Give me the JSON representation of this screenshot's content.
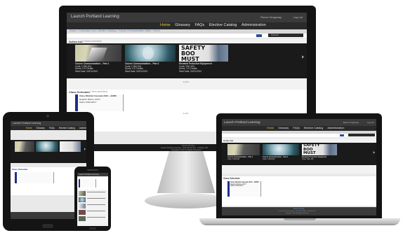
{
  "app": {
    "title": "Launch Portland Learning",
    "user_label": "Reece Kingsway",
    "logout_label": "Log out"
  },
  "nav": {
    "items": [
      {
        "label": "Home",
        "active": true
      },
      {
        "label": "Glossary",
        "active": false
      },
      {
        "label": "FAQs",
        "active": false
      },
      {
        "label": "Elective Catalog",
        "active": false
      },
      {
        "label": "Administration",
        "active": false
      }
    ]
  },
  "breadcrumb": {
    "text": "Home > Curriculum List > Elective Catalog > Course Communication Skills > Event"
  },
  "search": {
    "placeholder": "Search",
    "go_label": "Go"
  },
  "courses": {
    "header": "Active Ink",
    "sub": "(3 items selected)",
    "items": [
      {
        "title": "Course Communication – Part 1",
        "line1": "Code: COM-001",
        "line2": "Hours: 0.5 Credits",
        "line3": "Start Date: 02/01/2013"
      },
      {
        "title": "Course Communication – Part 2",
        "line1": "Code: COM-002",
        "line2": "Hours: 0.5 Credits",
        "line3": "Start Date: 02/01/2013"
      },
      {
        "title": "Elevated Protective Equipment",
        "line1": "Code: SAF-100",
        "line2": "Hours: 1.0 Credits",
        "line3": "Start Date: 02/01/2013"
      }
    ],
    "safety_sign_text": "SAFETY BOO MUST",
    "pager": "1 of 3"
  },
  "schedule": {
    "header": "Class Schedule",
    "sub": "(1 item selected)",
    "card": {
      "title": "Class Wishlist Cascade 2016 – ADMS",
      "line1": "Register Before 1/6/17",
      "line2": "Starts: 09/01/2017"
    },
    "pager": "1 of 1"
  },
  "footer": {
    "link": "Terms Of Use",
    "line1": "Launch Portland Learning · 1221 SW 4th Ave · Portland, OR",
    "line2": "Copyright © 2017 All Rights Reserved"
  },
  "colors": {
    "accent": "#f0c040",
    "blue_bar": "#1f2e8a",
    "nav_bg": "#2a2a2a",
    "header_bg": "#3a3a3a"
  }
}
